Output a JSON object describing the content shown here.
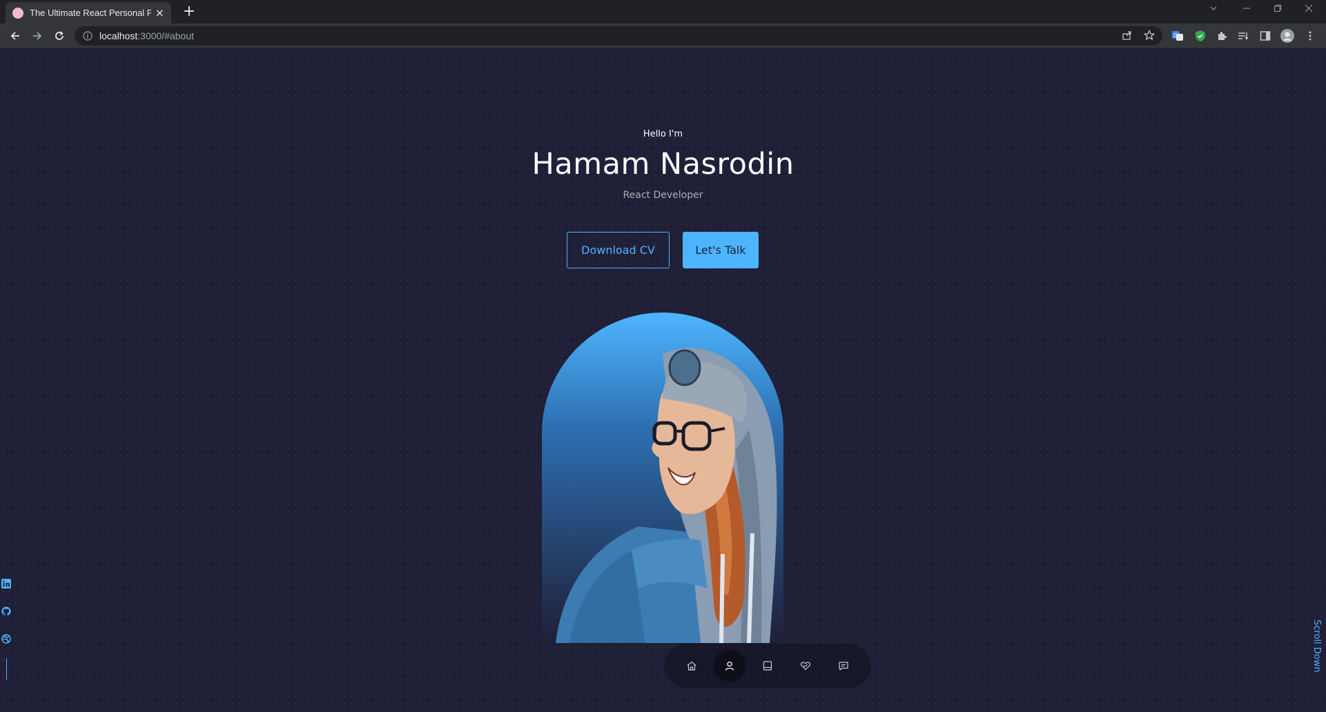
{
  "browser": {
    "tab_title": "The Ultimate React Personal Portfolio",
    "tab_close": "×",
    "new_tab": "+",
    "url_host": "localhost",
    "url_rest": ":3000/#about"
  },
  "header": {
    "greeting": "Hello I'm",
    "name": "Hamam Nasrodin",
    "role": "React Developer"
  },
  "cta": {
    "download_label": "Download CV",
    "talk_label": "Let's Talk"
  },
  "socials": [
    "linkedin-icon",
    "github-icon",
    "dribbble-icon"
  ],
  "scroll_label": "Scroll Down",
  "bottom_nav": {
    "items": [
      "home-icon",
      "user-icon",
      "book-icon",
      "services-icon",
      "message-icon"
    ],
    "active": "user-icon"
  },
  "colors": {
    "background": "#1f1f38",
    "accent": "#4db5ff"
  }
}
